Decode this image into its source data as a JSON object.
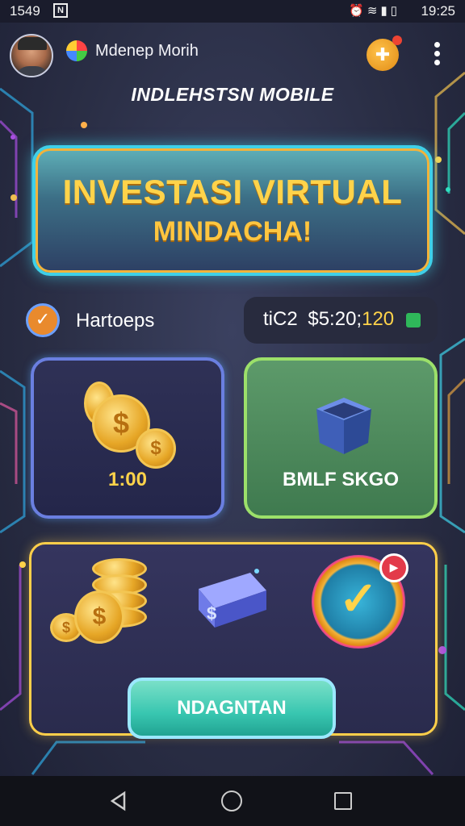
{
  "status_bar": {
    "time_left": "1549",
    "time_right": "19:25",
    "notification_glyph": "N",
    "status_icons": [
      "alarm-icon",
      "wifi-icon",
      "signal-icon",
      "battery-icon"
    ]
  },
  "header": {
    "app_name": "Mdenep Morih",
    "subtitle": "INDLEHSTSN MOBILE",
    "icons": [
      "avatar",
      "app-logo-icon",
      "puzzle-icon",
      "more-vert-icon"
    ]
  },
  "hero": {
    "line1": "INVESTASI VIRTUAL",
    "line2": "MINDACHA!"
  },
  "status_row": {
    "check_label": "Hartoeps",
    "stat_prefix": "tiC2",
    "stat_amount": "$5:20;",
    "stat_count": "120"
  },
  "cards": {
    "coins_label": "1:00",
    "box_label": "BMLF SKGO"
  },
  "panel": {
    "button_label": "NDAGNTAN"
  },
  "colors": {
    "accent_gold": "#ffd34a",
    "accent_cyan": "#3fd0e8",
    "card_green": "#5d9a6a",
    "background": "#2a2e45"
  }
}
